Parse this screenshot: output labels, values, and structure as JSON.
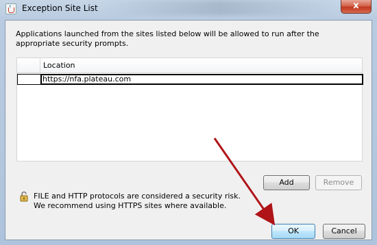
{
  "window": {
    "title": "Exception Site List",
    "close_glyph": "x",
    "close_color": "#c2391f"
  },
  "description": "Applications launched from the sites listed below will be allowed to run after the appropriate security prompts.",
  "table": {
    "columns": [
      "",
      "Location"
    ],
    "rows": [
      {
        "index": "",
        "location": "https://nfa.plateau.com"
      }
    ]
  },
  "buttons": {
    "add": "Add",
    "remove": "Remove",
    "ok": "OK",
    "cancel": "Cancel"
  },
  "warning": {
    "icon": "lock-icon",
    "line1": "FILE and HTTP protocols are considered a security risk.",
    "line2": "We recommend using HTTPS sites where available."
  },
  "annotation": {
    "arrow_color": "#b01418",
    "points_to": "ok-button"
  }
}
